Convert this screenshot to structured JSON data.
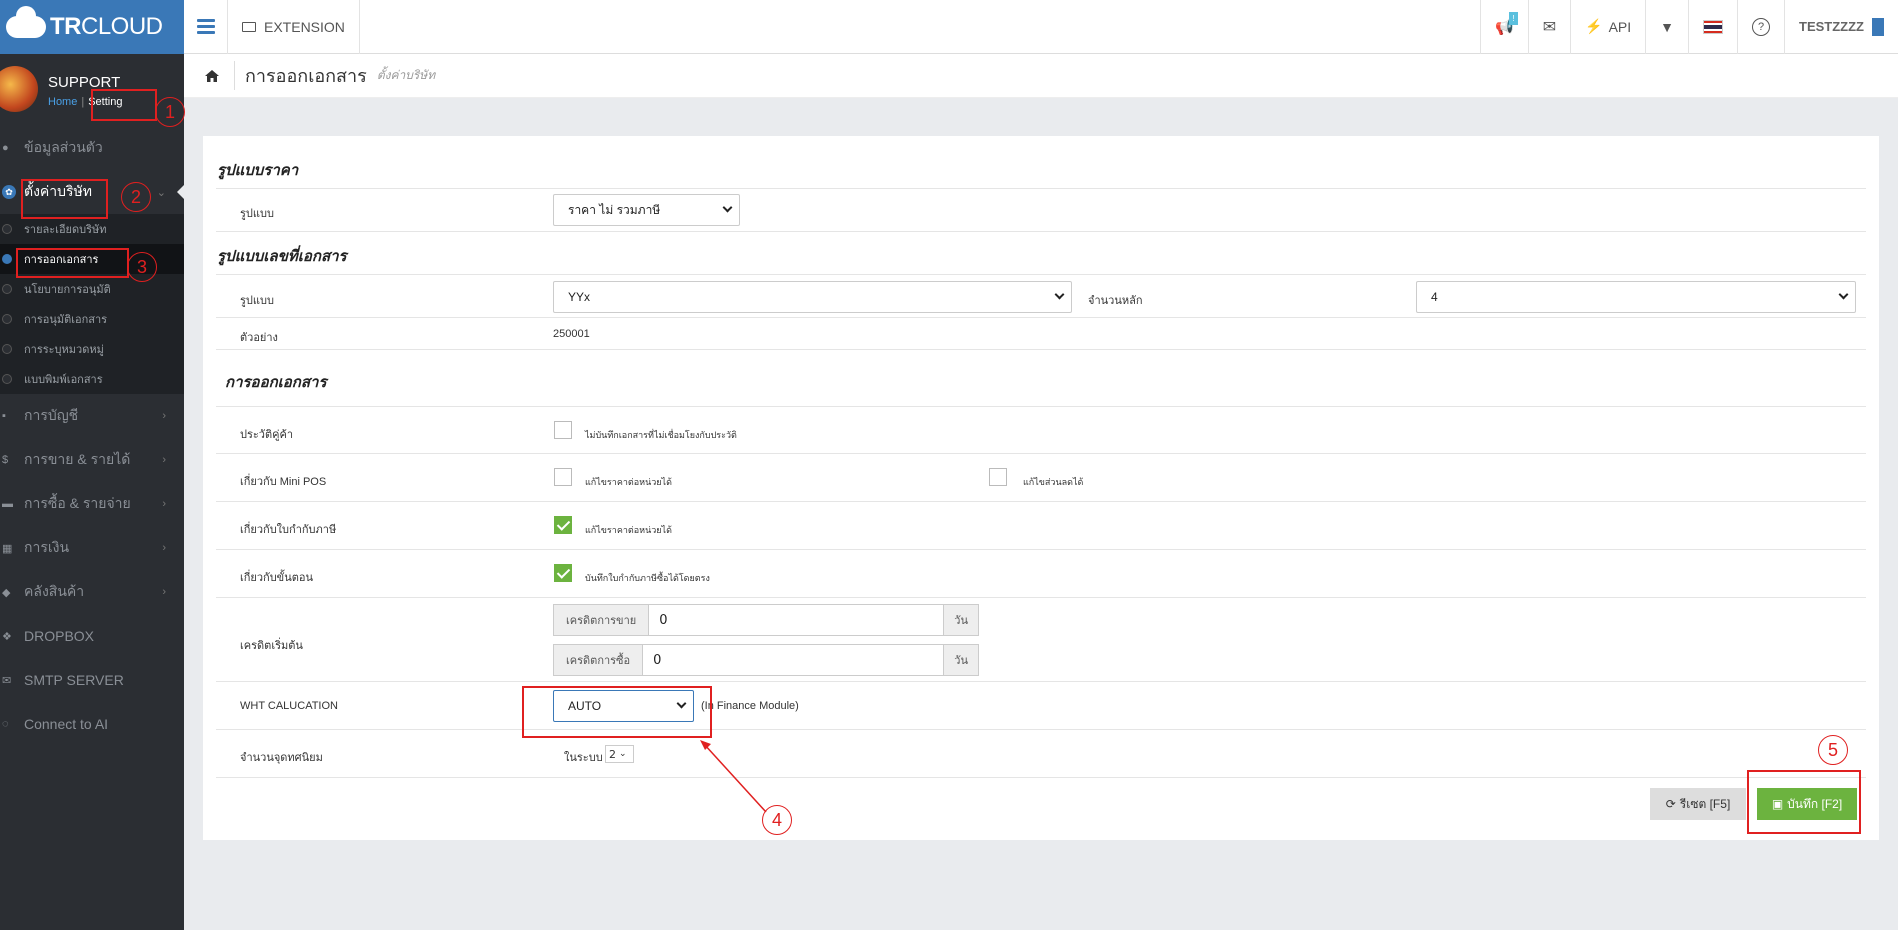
{
  "app": {
    "logo_bold": "TR",
    "logo_rest": "CLOUD"
  },
  "profile": {
    "name": "SUPPORT",
    "home_link": "Home",
    "separator": "|",
    "setting_link": "Setting"
  },
  "sidebar": {
    "items_top": [
      {
        "label": "ข้อมูลส่วนตัว",
        "icon": "user-icon"
      },
      {
        "label": "ตั้งค่าบริษัท",
        "icon": "gear-icon"
      }
    ],
    "submenu": [
      {
        "label": "รายละเอียดบริษัท"
      },
      {
        "label": "การออกเอกสาร"
      },
      {
        "label": "นโยบายการอนุมัติ"
      },
      {
        "label": "การอนุมัติเอกสาร"
      },
      {
        "label": "การระบุหมวดหมู่"
      },
      {
        "label": "แบบพิมพ์เอกสาร"
      }
    ],
    "items_bottom": [
      {
        "label": "การบัญชี",
        "icon": "book-icon"
      },
      {
        "label": "การขาย & รายได้",
        "icon": "dollar-icon"
      },
      {
        "label": "การซื้อ & รายจ่าย",
        "icon": "cart-icon"
      },
      {
        "label": "การเงิน",
        "icon": "calendar-icon"
      },
      {
        "label": "คลังสินค้า",
        "icon": "box-icon"
      },
      {
        "label": "DROPBOX",
        "icon": "dropbox-icon"
      },
      {
        "label": "SMTP SERVER",
        "icon": "mail-icon"
      },
      {
        "label": "Connect to AI",
        "icon": "chat-icon"
      }
    ]
  },
  "topbar": {
    "extension_label": "EXTENSION",
    "notification_badge": "!",
    "api_label": "API",
    "user_label": "TESTZZZZ"
  },
  "header": {
    "title": "การออกเอกสาร",
    "subtitle": "ตั้งค่าบริษัท"
  },
  "form": {
    "price_section": {
      "title": "รูปแบบราคา",
      "format_label": "รูปแบบ",
      "format_value": "ราคา ไม่ รวมภาษี"
    },
    "docno_section": {
      "title": "รูปแบบเลขที่เอกสาร",
      "format_label": "รูปแบบ",
      "format_value": "YYx",
      "digits_label": "จำนวนหลัก",
      "digits_value": "4",
      "example_label": "ตัวอย่าง",
      "example_value": "250001"
    },
    "issue_section": {
      "title": "การออกเอกสาร",
      "partner_history": {
        "label": "ประวัติคู่ค้า",
        "checkbox": "ไม่บันทึกเอกสารที่ไม่เชื่อมโยงกับประวัติ",
        "checked": false
      },
      "mini_pos": {
        "label": "เกี่ยวกับ Mini POS",
        "checkbox1": "แก้ไขราคาต่อหน่วยได้",
        "checkbox2": "แก้ไขส่วนลดได้",
        "checked1": false,
        "checked2": false
      },
      "tax_invoice": {
        "label": "เกี่ยวกับใบกำกับภาษี",
        "checkbox": "แก้ไขราคาต่อหน่วยได้",
        "checked": true
      },
      "workflow": {
        "label": "เกี่ยวกับขั้นตอน",
        "checkbox": "บันทึกใบกำกับภาษีซื้อได้โดยตรง",
        "checked": true
      },
      "credit": {
        "label": "เครดิตเริ่มต้น",
        "sale_label": "เครดิตการขาย",
        "sale_value": "0",
        "sale_unit": "วัน",
        "purchase_label": "เครดิตการซื้อ",
        "purchase_value": "0",
        "purchase_unit": "วัน"
      },
      "wht": {
        "label": "WHT CALUCATION",
        "value": "AUTO",
        "note": "(In Finance Module)"
      },
      "decimals": {
        "label": "จำนวนจุดทศนิยม",
        "prefix": "ในระบบ",
        "value": "2"
      }
    },
    "buttons": {
      "reset": "รีเซต [F5]",
      "save": "บันทึก [F2]"
    }
  },
  "annotations": [
    "1",
    "2",
    "3",
    "4",
    "5"
  ],
  "colors": {
    "brand": "#3a78b7",
    "sidebar": "#2b2e33",
    "save": "#6cb33f",
    "annotation": "#e02020"
  }
}
